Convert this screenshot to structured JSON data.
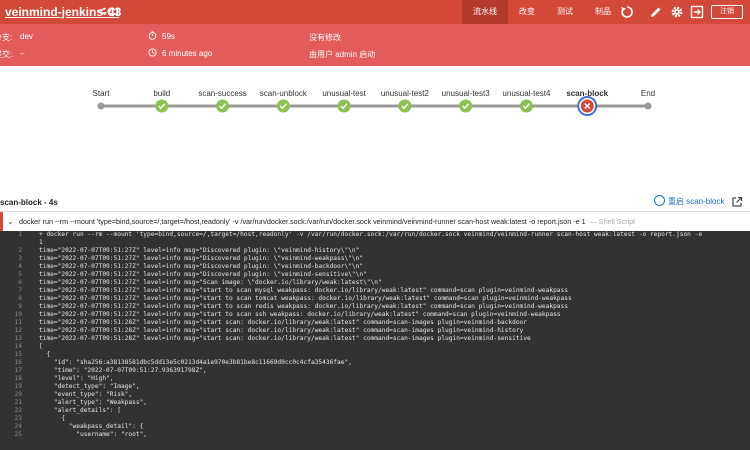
{
  "header": {
    "job_name": "veinmind-jenkins-CI",
    "separator": "<",
    "build_number": "43",
    "tabs": [
      {
        "label": "流水线",
        "active": true
      },
      {
        "label": "改变",
        "active": false
      },
      {
        "label": "测试",
        "active": false
      },
      {
        "label": "制品",
        "active": false
      }
    ],
    "icons": [
      "replay-icon",
      "edit-icon",
      "settings-icon",
      "exit-icon"
    ],
    "logout_label": "注销",
    "colors": {
      "header": "#d24939",
      "band": "#e35c5c",
      "success": "#8cc04f",
      "failure": "#d24939"
    }
  },
  "info": {
    "branch_label": "分支:",
    "branch_value": "dev",
    "commit_label": "提交:",
    "commit_value": "–",
    "duration_icon": "stopwatch-icon",
    "duration": "59s",
    "time_icon": "clock-icon",
    "time_ago": "6 minutes ago",
    "changes": "没有修改",
    "started_by": "由用户 admin 启动"
  },
  "pipeline": {
    "stages": [
      {
        "name": "Start",
        "status": "start"
      },
      {
        "name": "build",
        "status": "success"
      },
      {
        "name": "scan-success",
        "status": "success"
      },
      {
        "name": "scan-unblock",
        "status": "success"
      },
      {
        "name": "unusual-test",
        "status": "success"
      },
      {
        "name": "unusual-test2",
        "status": "success"
      },
      {
        "name": "unusual-test3",
        "status": "success"
      },
      {
        "name": "unusual-test4",
        "status": "success"
      },
      {
        "name": "scan-block",
        "status": "failure",
        "selected": true
      },
      {
        "name": "End",
        "status": "end"
      }
    ]
  },
  "log": {
    "title": "scan-block - 4s",
    "restart_label": "重启 scan-block",
    "step_command": "docker run --rm --mount 'type=bind,source=/,target=/host,readonly' -v /var/run/docker.sock:/var/run/docker.sock veinmind/veinmind-runner scan-host weak:latest -o report.json -e 1",
    "step_kind": "— Shell Script",
    "lines": [
      {
        "n": "1",
        "t": "+ docker run --rm --mount 'type=bind,source=/,target=/host,readonly' -v /var/run/docker.sock:/var/run/docker.sock veinmind/veinmind-runner scan-host weak:latest -o report.json -e"
      },
      {
        "n": "",
        "t": "1"
      },
      {
        "n": "2",
        "t": "time=\"2022-07-07T09:51:27Z\" level=info msg=\"Discovered plugin: \\\"veinmind-history\\\"\\n\""
      },
      {
        "n": "3",
        "t": "time=\"2022-07-07T09:51:27Z\" level=info msg=\"Discovered plugin: \\\"veinmind-weakpass\\\"\\n\""
      },
      {
        "n": "4",
        "t": "time=\"2022-07-07T09:51:27Z\" level=info msg=\"Discovered plugin: \\\"veinmind-backdoor\\\"\\n\""
      },
      {
        "n": "5",
        "t": "time=\"2022-07-07T09:51:27Z\" level=info msg=\"Discovered plugin: \\\"veinmind-sensitive\\\"\\n\""
      },
      {
        "n": "6",
        "t": "time=\"2022-07-07T09:51:27Z\" level=info msg=\"Scan image: \\\"docker.io/library/weak:latest\\\"\\n\""
      },
      {
        "n": "7",
        "t": "time=\"2022-07-07T09:51:27Z\" level=info msg=\"start to scan mysql weakpass: docker.io/library/weak:latest\" command=scan plugin=veinmind-weakpass"
      },
      {
        "n": "8",
        "t": "time=\"2022-07-07T09:51:27Z\" level=info msg=\"start to scan tomcat weakpass: docker.io/library/weak:latest\" command=scan plugin=veinmind-weakpass"
      },
      {
        "n": "9",
        "t": "time=\"2022-07-07T09:51:27Z\" level=info msg=\"start to scan redis weakpass: docker.io/library/weak:latest\" command=scan plugin=veinmind-weakpass"
      },
      {
        "n": "10",
        "t": "time=\"2022-07-07T09:51:27Z\" level=info msg=\"start to scan ssh weakpass: docker.io/library/weak:latest\" command=scan plugin=veinmind-weakpass"
      },
      {
        "n": "11",
        "t": "time=\"2022-07-07T09:51:28Z\" level=info msg=\"start scan: docker.io/library/weak:latest\" command=scan-images plugin=veinmind-backdoor"
      },
      {
        "n": "12",
        "t": "time=\"2022-07-07T09:51:28Z\" level=info msg=\"start scan: docker.io/library/weak:latest\" command=scan-images plugin=veinmind-history"
      },
      {
        "n": "13",
        "t": "time=\"2022-07-07T09:51:28Z\" level=info msg=\"start scan: docker.io/library/weak:latest\" command=scan-images plugin=veinmind-sensitive"
      },
      {
        "n": "14",
        "t": "["
      },
      {
        "n": "15",
        "t": "  {"
      },
      {
        "n": "16",
        "t": "    \"id\": \"sha256:a38138581dbc5dd13e5c0213d4a1e970e3b81be8c11669d0cc0c4cfa35436fae\","
      },
      {
        "n": "17",
        "t": "    \"time\": \"2022-07-07T09:51:27.936391798Z\","
      },
      {
        "n": "18",
        "t": "    \"level\": \"High\","
      },
      {
        "n": "19",
        "t": "    \"detect_type\": \"Image\","
      },
      {
        "n": "20",
        "t": "    \"event_type\": \"Risk\","
      },
      {
        "n": "21",
        "t": "    \"alert_type\": \"Weakpass\","
      },
      {
        "n": "22",
        "t": "    \"alert_details\": ["
      },
      {
        "n": "23",
        "t": "      {"
      },
      {
        "n": "24",
        "t": "        \"weakpass_detail\": {"
      },
      {
        "n": "25",
        "t": "          \"username\": \"root\","
      }
    ]
  }
}
